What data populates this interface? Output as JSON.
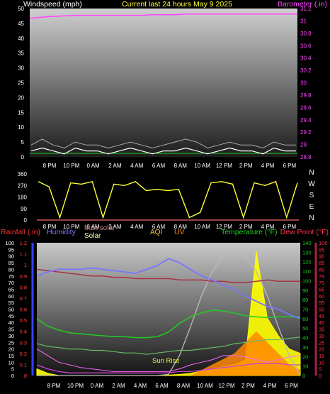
{
  "header": {
    "windspeed_label": "Windspeed (mph)",
    "title": "Current last 24 hours May 9 2025",
    "barometer_label": "Barometer (.in)"
  },
  "bottom_header": {
    "rainfall": "Rainfall (.in)",
    "humidity": "Humidity",
    "max_solar": "Max solar",
    "solar": "Solar",
    "aqi": "AQI",
    "uv": "UV",
    "temperature": "Temperature (°F)",
    "dewpoint": "Dew Point (°F)"
  },
  "colors": {
    "windspeed": "#ffffff",
    "gust": "#aaaaaa",
    "barometer": "#ff44ff",
    "direction": "#ffff33",
    "rain": "#3344ff",
    "humidity": "#7777ff",
    "max_solar": "#cc8888",
    "solar": "#ffff00",
    "uv": "#ff8800",
    "aqi": "#ffcc33",
    "temperature": "#22cc22",
    "dewpoint": "#cc3355",
    "pressure_trend": "#aa3344"
  },
  "annotation": "Sun Rise",
  "time_ticks": [
    "8 PM",
    "10 PM",
    "0 AM",
    "2 AM",
    "4 AM",
    "6 AM",
    "8 AM",
    "10 AM",
    "12 PM",
    "2 PM",
    "4 PM",
    "6 PM"
  ],
  "chart_data": [
    {
      "type": "line",
      "name": "wind-barometer",
      "x_ticks": [
        "8 PM",
        "10 PM",
        "0 AM",
        "2 AM",
        "4 AM",
        "6 AM",
        "8 AM",
        "10 AM",
        "12 PM",
        "2 PM",
        "4 PM",
        "6 PM"
      ],
      "y_left": {
        "label": "Windspeed (mph)",
        "range": [
          0,
          50
        ],
        "ticks": [
          "0",
          "5",
          "10",
          "15",
          "20",
          "25",
          "30",
          "35",
          "40",
          "45",
          "50"
        ]
      },
      "y_right": {
        "label": "Barometer (.in)",
        "range": [
          28.8,
          31.2
        ],
        "ticks": [
          "28.8",
          "29",
          "29.2",
          "29.4",
          "29.6",
          "29.8",
          "30",
          "30.2",
          "30.4",
          "30.6",
          "30.8",
          "31",
          "31.2"
        ]
      },
      "series": [
        {
          "values": [
            2,
            3,
            2,
            1,
            3,
            2,
            2,
            1,
            2,
            3,
            2,
            1,
            2,
            2,
            3,
            2,
            1,
            2,
            3,
            2,
            2,
            1,
            3,
            2,
            2
          ]
        },
        {
          "values": [
            4,
            6,
            4,
            3,
            5,
            4,
            4,
            3,
            4,
            5,
            4,
            3,
            4,
            5,
            6,
            5,
            3,
            4,
            5,
            4,
            4,
            3,
            5,
            4,
            4
          ]
        },
        {
          "values": [
            31.04,
            31.06,
            31.07,
            31.08,
            31.09,
            31.09,
            31.09,
            31.09,
            31.09,
            31.09,
            31.09,
            31.1,
            31.1,
            31.1,
            31.11,
            31.11,
            31.11,
            31.11,
            31.11,
            31.11,
            31.11,
            31.11,
            31.11,
            31.11,
            31.11
          ]
        }
      ]
    },
    {
      "type": "line",
      "name": "wind-direction",
      "x_ticks": [
        "8 PM",
        "10 PM",
        "0 AM",
        "2 AM",
        "4 AM",
        "6 AM",
        "8 AM",
        "10 AM",
        "12 PM",
        "2 PM",
        "4 PM",
        "6 PM"
      ],
      "y_left": {
        "range": [
          0,
          360
        ],
        "ticks": [
          "0",
          "90",
          "180",
          "270",
          "360"
        ]
      },
      "y_right_labels": [
        "N",
        "W",
        "S",
        "E",
        "N"
      ],
      "series": [
        {
          "values": [
            300,
            260,
            20,
            290,
            280,
            300,
            20,
            280,
            270,
            300,
            230,
            240,
            230,
            240,
            20,
            60,
            290,
            300,
            280,
            20,
            290,
            270,
            300,
            20,
            290
          ]
        }
      ]
    },
    {
      "type": "line",
      "name": "weather-multi",
      "x_ticks": [
        "8 PM",
        "10 PM",
        "0 AM",
        "2 AM",
        "4 AM",
        "6 AM",
        "8 AM",
        "10 AM",
        "12 PM",
        "2 PM",
        "4 PM",
        "6 PM"
      ],
      "y_left_rain": {
        "label": "Rainfall (.in)",
        "range": [
          0,
          1.2
        ],
        "ticks": [
          "0",
          "0.1",
          "0.2",
          "0.3",
          "0.4",
          "0.5",
          "0.6",
          "0.7",
          "0.8",
          "0.9",
          "1",
          "1.1",
          "1.2"
        ]
      },
      "y_left_humidity": {
        "label": "Humidity",
        "range": [
          0,
          100
        ],
        "ticks": [
          "0",
          "5",
          "10",
          "15",
          "20",
          "25",
          "30",
          "35",
          "40",
          "45",
          "50",
          "55",
          "60",
          "65",
          "70",
          "75",
          "80",
          "85",
          "90",
          "95",
          "100"
        ]
      },
      "y_right_temp": {
        "label": "Temperature (°F)",
        "range": [
          0,
          140
        ],
        "ticks": [
          "0",
          "10",
          "20",
          "30",
          "40",
          "50",
          "60",
          "70",
          "80",
          "90",
          "100",
          "110",
          "120",
          "130",
          "140"
        ]
      },
      "y_right_dew": {
        "label": "Dew Point (°F)",
        "range": [
          0,
          100
        ],
        "ticks": [
          "0",
          "5",
          "10",
          "15",
          "20",
          "25",
          "30",
          "35",
          "40",
          "45",
          "50",
          "55",
          "60",
          "65",
          "70",
          "75",
          "80",
          "85",
          "90",
          "95",
          "100"
        ]
      },
      "series": [
        {
          "values": [
            75,
            78,
            80,
            80,
            80,
            81,
            80,
            79,
            78,
            77,
            80,
            83,
            88,
            85,
            80,
            75,
            72,
            68,
            65,
            60,
            56,
            52,
            50,
            46,
            43
          ]
        },
        {
          "values": [
            60,
            52,
            48,
            45,
            44,
            43,
            42,
            41,
            41,
            40,
            40,
            41,
            46,
            55,
            62,
            66,
            69,
            68,
            66,
            63,
            62,
            61,
            62,
            62,
            62
          ]
        },
        {
          "values": [
            24,
            22,
            21,
            20,
            20,
            19,
            19,
            18,
            17,
            17,
            16,
            17,
            18,
            19,
            19,
            20,
            21,
            22,
            24,
            25,
            26,
            27,
            27,
            28,
            29
          ]
        },
        {
          "values": [
            80,
            79,
            78,
            77,
            76,
            75,
            75,
            74,
            74,
            73,
            73,
            73,
            73,
            72,
            72,
            72,
            71,
            71,
            70,
            70,
            71,
            72,
            71,
            71,
            71
          ]
        },
        {
          "values": [
            20,
            15,
            10,
            8,
            6,
            5,
            4,
            3,
            3,
            3,
            3,
            3,
            3,
            5,
            8,
            10,
            12,
            15,
            15,
            14,
            12,
            10,
            12,
            14,
            15
          ]
        },
        {
          "values": [
            0,
            0,
            0,
            0,
            0,
            0,
            0,
            0,
            0,
            0,
            0,
            0,
            5,
            90,
            220,
            360,
            470,
            540,
            570,
            540,
            470,
            360,
            220,
            90,
            0
          ]
        },
        {
          "values": [
            30,
            10,
            0,
            0,
            0,
            0,
            0,
            0,
            0,
            0,
            0,
            0,
            2,
            5,
            10,
            20,
            30,
            40,
            50,
            70,
            560,
            260,
            180,
            120,
            100
          ]
        },
        {
          "values": [
            0,
            0,
            0,
            0,
            0,
            0,
            0,
            0,
            0,
            0,
            0,
            0,
            0,
            0,
            0,
            0.5,
            1,
            1.5,
            2,
            3,
            4,
            3,
            2,
            1,
            0.5
          ]
        },
        {
          "values": [
            8,
            5,
            3,
            2,
            2,
            2,
            2,
            2,
            2,
            2,
            2,
            2,
            2,
            3,
            3,
            4,
            5,
            6,
            7,
            8,
            9,
            9,
            9,
            8,
            8
          ]
        }
      ]
    }
  ]
}
